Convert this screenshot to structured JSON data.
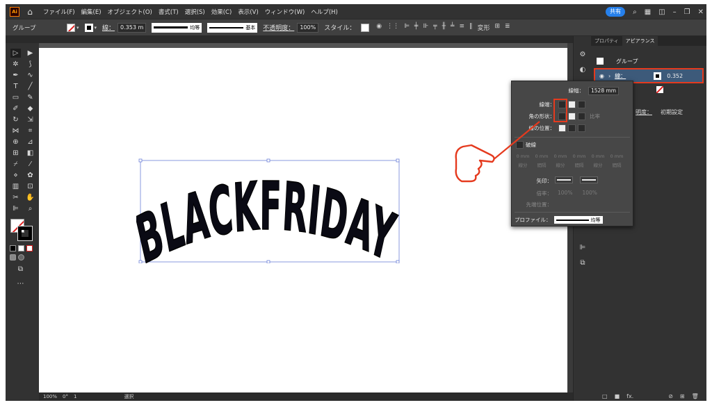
{
  "menubar": {
    "logo": "Ai",
    "items": [
      "ファイル(F)",
      "編集(E)",
      "オブジェクト(O)",
      "書式(T)",
      "選択(S)",
      "効果(C)",
      "表示(V)",
      "ウィンドウ(W)",
      "ヘルプ(H)"
    ],
    "share": "共有"
  },
  "controlbar": {
    "selection": "グループ",
    "stroke_label": "線：",
    "stroke_value": "0.353 m",
    "profile_label": "均等",
    "brush_label": "基本",
    "opacity_label": "不透明度：",
    "opacity_value": "100%",
    "style_label": "スタイル：",
    "shape_label": "変形"
  },
  "artwork": {
    "text": "BLACKFRIDAY"
  },
  "stroke_panel": {
    "width_label": "線幅：",
    "width_value": "1528 mm",
    "cap_label": "線端：",
    "corner_label": "角の形状：",
    "limit_label": "比率",
    "align_label": "線の位置：",
    "dashed_label": "破線",
    "dash_cells": [
      "0 mm",
      "0 mm",
      "0 mm",
      "0 mm",
      "0 mm",
      "0 mm"
    ],
    "dash_labels": [
      "線分",
      "間隔",
      "線分",
      "間隔",
      "線分",
      "間隔"
    ],
    "arrow_label": "矢印：",
    "scale_label": "倍率：",
    "scale_values": [
      "100%",
      "100%"
    ],
    "tip_label": "先端位置：",
    "profile_label": "プロファイル：",
    "profile_value": "均等"
  },
  "appearance_panel": {
    "tabs": [
      "プロパティ",
      "アピアランス"
    ],
    "item_title": "グループ",
    "stroke_label": "線：",
    "stroke_value": "0.352",
    "opacity_label": "明度：",
    "opacity_value": "初期設定",
    "fx": "fx."
  },
  "status": {
    "zoom": "100%",
    "rotate": "0°",
    "page": "1",
    "tool": "選択"
  },
  "colors": {
    "highlight": "#e53a1e",
    "pointer": "#e53a1e",
    "ui_dark": "#323232"
  }
}
